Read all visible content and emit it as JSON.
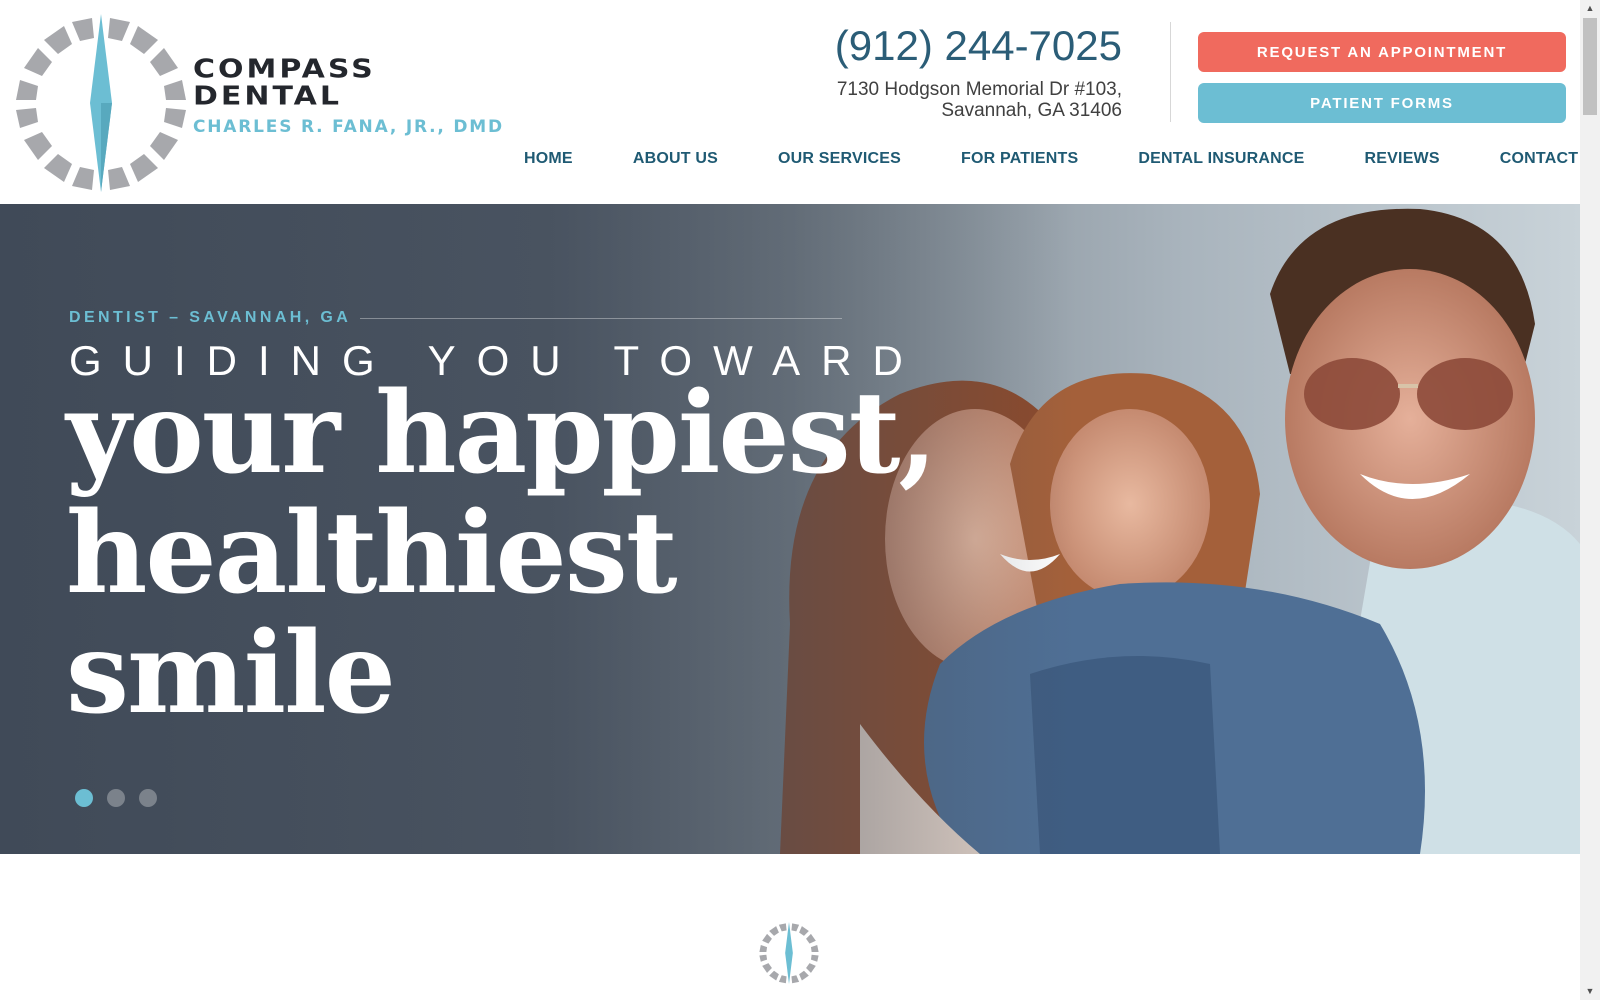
{
  "colors": {
    "accent_blue": "#6cbed3",
    "accent_coral": "#f06a5e",
    "nav_text": "#1f5a73",
    "phone_text": "#2b5d77",
    "logo_dark": "#24272d"
  },
  "logo": {
    "line1": "COMPASS",
    "line2": "DENTAL",
    "doctor": "CHARLES R. FANA, JR., DMD",
    "icon": "compass-icon"
  },
  "contact": {
    "phone": "(912) 244-7025",
    "address_line1": "7130 Hodgson Memorial Dr #103,",
    "address_line2": "Savannah, GA 31406"
  },
  "buttons": {
    "appointment": "REQUEST AN APPOINTMENT",
    "patient_forms": "PATIENT FORMS"
  },
  "nav": {
    "items": [
      {
        "label": "HOME"
      },
      {
        "label": "ABOUT US"
      },
      {
        "label": "OUR SERVICES"
      },
      {
        "label": "FOR PATIENTS"
      },
      {
        "label": "DENTAL INSURANCE"
      },
      {
        "label": "REVIEWS"
      },
      {
        "label": "CONTACT"
      }
    ]
  },
  "hero": {
    "eyebrow": "DENTIST – SAVANNAH, GA",
    "subhead": "GUIDING YOU TOWARD",
    "headline_line1": "your happiest,",
    "headline_line2": "healthiest",
    "headline_line3": "smile",
    "slide_count": 3,
    "active_slide": 1
  }
}
